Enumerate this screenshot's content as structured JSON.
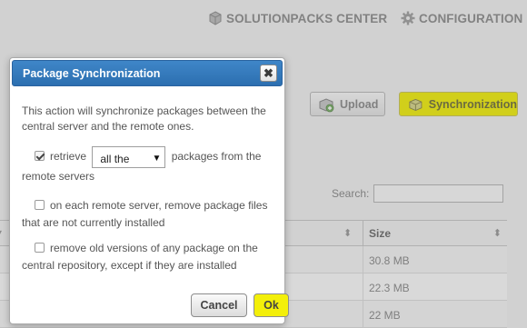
{
  "topnav": {
    "packs_label": "SOLUTIONPACKS CENTER",
    "config_label": "CONFIGURATION"
  },
  "toolbar": {
    "upload_label": "Upload",
    "sync_label": "Synchronization"
  },
  "search": {
    "label": "Search:",
    "placeholder": ""
  },
  "table": {
    "size_header": "Size",
    "rows": [
      {
        "size": "30.8 MB"
      },
      {
        "size": "22.3 MB"
      },
      {
        "size": "22 MB"
      }
    ]
  },
  "dialog": {
    "title": "Package Synchronization",
    "close_label": "✖",
    "intro": "This action will synchronize packages between the central server and the remote ones.",
    "option1": {
      "checked": true,
      "prefix": "retrieve",
      "select_value": "all the",
      "suffix": "packages from the remote servers"
    },
    "option2": {
      "checked": false,
      "text": "on each remote server, remove package files that are not currently installed"
    },
    "option3": {
      "checked": false,
      "text": "remove old versions of any package on the central repository, except if they are installed"
    },
    "cancel_label": "Cancel",
    "ok_label": "Ok"
  },
  "colors": {
    "accent_highlight": "#f3ef0a",
    "titlebar": "#2c6fb0"
  },
  "icons": {
    "packs": "cube-icon",
    "config": "gear-icon",
    "upload": "box-upload-icon",
    "sync": "box-sync-icon",
    "close": "close-icon",
    "caret": "caret-down-icon"
  }
}
